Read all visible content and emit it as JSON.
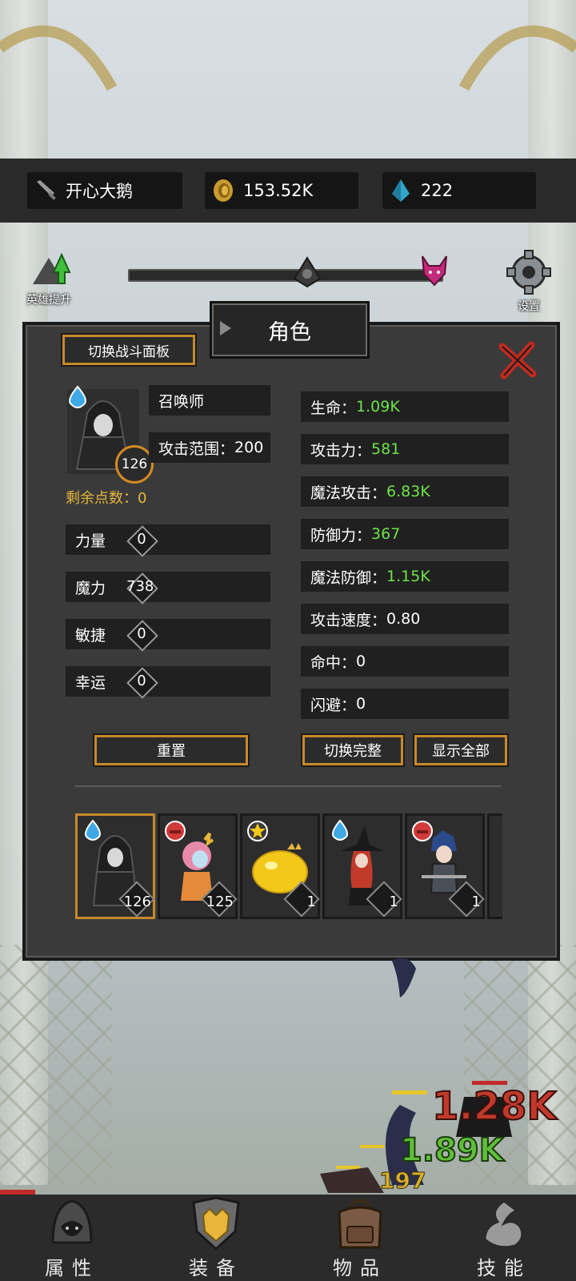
{
  "resources": {
    "player_name": "开心大鹅",
    "gold": "153.52K",
    "gems": "222"
  },
  "header": {
    "hero_upgrade_label": "英雄提升",
    "settings_label": "设置"
  },
  "panel": {
    "title": "角色",
    "toggle_panel_label": "切换战斗面板",
    "hero": {
      "name": "召唤师",
      "range_label": "攻击范围：",
      "range_value": "200",
      "level": "126"
    },
    "points_label": "剩余点数：",
    "points_value": "0",
    "attributes": [
      {
        "label": "力量",
        "value": "0"
      },
      {
        "label": "魔力",
        "value": "738"
      },
      {
        "label": "敏捷",
        "value": "0"
      },
      {
        "label": "幸运",
        "value": "0"
      }
    ],
    "stats": [
      {
        "label": "生命：",
        "value": "1.09K"
      },
      {
        "label": "攻击力：",
        "value": "581"
      },
      {
        "label": "魔法攻击：",
        "value": "6.83K"
      },
      {
        "label": "防御力：",
        "value": "367"
      },
      {
        "label": "魔法防御：",
        "value": "1.15K"
      },
      {
        "label": "攻击速度：",
        "value": "0.80"
      },
      {
        "label": "命中：",
        "value": "0"
      },
      {
        "label": "闪避：",
        "value": "0"
      }
    ],
    "reset_label": "重置",
    "toggle_full_label": "切换完整",
    "show_all_label": "显示全部",
    "heroes": [
      {
        "level": "126",
        "badge": "water-drop-icon"
      },
      {
        "level": "125",
        "badge": "boxing-glove-icon"
      },
      {
        "level": "1",
        "badge": "star-icon"
      },
      {
        "level": "1",
        "badge": "water-drop-icon"
      },
      {
        "level": "1",
        "badge": "boxing-glove-icon"
      }
    ]
  },
  "battle": {
    "damage_1": "1.28K",
    "damage_2": "1.89K",
    "damage_3": "197"
  },
  "bottom_nav": [
    {
      "label": "属性"
    },
    {
      "label": "装备"
    },
    {
      "label": "物品"
    },
    {
      "label": "技能"
    }
  ],
  "colors": {
    "accent_gold": "#c7892c",
    "stat_green": "#6ee34b",
    "points_yellow": "#e7b63a"
  }
}
